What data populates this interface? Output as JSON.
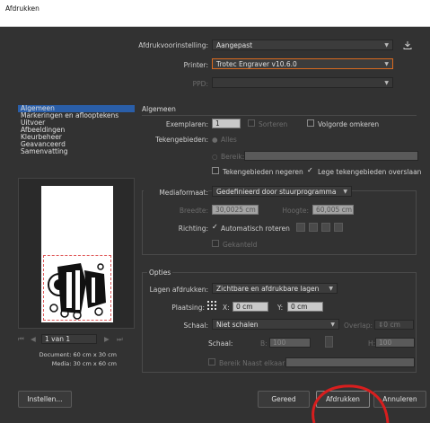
{
  "window": {
    "title": "Afdrukken"
  },
  "top": {
    "preset_label": "Afdrukvoorinstelling:",
    "preset_value": "Aangepast",
    "printer_label": "Printer:",
    "printer_value": "Trotec Engraver v10.6.0",
    "ppd_label": "PPD:"
  },
  "sidebar": {
    "items": [
      {
        "label": "Algemeen"
      },
      {
        "label": "Markeringen en aflooptekens"
      },
      {
        "label": "Uitvoer"
      },
      {
        "label": "Afbeeldingen"
      },
      {
        "label": "Kleurbeheer"
      },
      {
        "label": "Geavanceerd"
      },
      {
        "label": "Samenvatting"
      }
    ]
  },
  "preview": {
    "page_value": "1 van 1",
    "document_info": "Document: 60 cm x 30 cm",
    "media_info": "Media: 30 cm x 60 cm"
  },
  "general": {
    "title": "Algemeen",
    "copies_label": "Exemplaren:",
    "copies_value": "1",
    "sort_label": "Sorteren",
    "reverse_label": "Volgorde omkeren",
    "artboards_label": "Tekengebieden:",
    "all_label": "Alles",
    "range_label": "Bereik:",
    "ignore_artboards_label": "Tekengebieden negeren",
    "skip_blank_label": "Lege tekengebieden overslaan"
  },
  "media": {
    "format_label": "Mediaformaat:",
    "format_value": "Gedefinieerd door stuurprogramma",
    "width_label": "Breedte:",
    "width_value": "30,0025 cm",
    "height_label": "Hoogte:",
    "height_value": "60,005 cm",
    "orientation_label": "Richting:",
    "auto_rotate_label": "Automatisch roteren",
    "transverse_label": "Gekanteld"
  },
  "options": {
    "title": "Opties",
    "layers_label": "Lagen afdrukken:",
    "layers_value": "Zichtbare en afdrukbare lagen",
    "placement_label": "Plaatsing:",
    "x_label": "X:",
    "x_value": "0 cm",
    "y_label": "Y:",
    "y_value": "0 cm",
    "scale_label": "Schaal:",
    "scale_value": "Niet schalen",
    "overlap_label": "Overlap:",
    "overlap_value": "0 cm",
    "scale2_label": "Schaal:",
    "w_label": "B:",
    "w_value": "100",
    "h_label": "H:",
    "h_value": "100",
    "tile_label": "Bereik Naast elkaar:"
  },
  "buttons": {
    "setup": "Instellen...",
    "done": "Gereed",
    "print": "Afdrukken",
    "cancel": "Annuleren"
  },
  "colors": {
    "selection": "#2a5ea8",
    "focus": "#d96a1f",
    "annotation": "#d81e1e"
  }
}
